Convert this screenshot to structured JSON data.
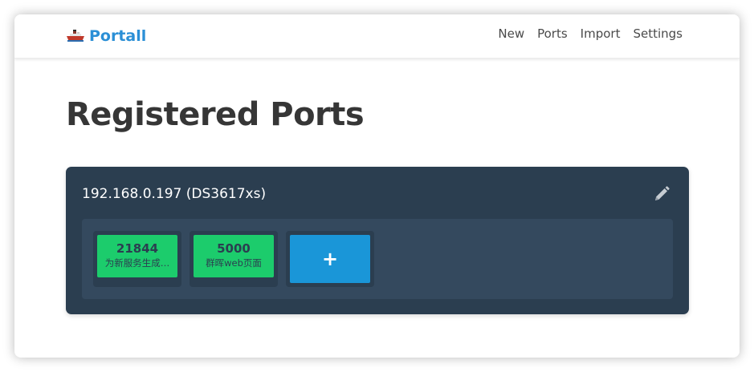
{
  "app": {
    "name": "Portall",
    "logo_icon": "ship-icon"
  },
  "nav": {
    "links": [
      "New",
      "Ports",
      "Import",
      "Settings"
    ]
  },
  "page": {
    "title": "Registered Ports"
  },
  "host": {
    "name": "192.168.0.197 (DS3617xs)",
    "edit_icon": "pencil-icon",
    "ports": [
      {
        "number": "21844",
        "description": "为新服务生成…"
      },
      {
        "number": "5000",
        "description": "群晖web页面"
      }
    ],
    "add_label": "+"
  },
  "colors": {
    "brand": "#2b8fd6",
    "card_bg": "#2b3e50",
    "panel_bg": "#34495e",
    "port_green": "#1ccc6c",
    "add_blue": "#1a96d8"
  }
}
